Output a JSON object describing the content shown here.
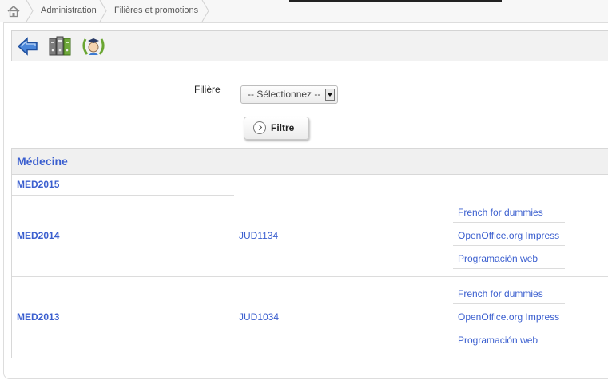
{
  "breadcrumb": {
    "items": [
      {
        "label": "Administration"
      },
      {
        "label": "Filières et promotions"
      }
    ]
  },
  "toolbar": {
    "icons": [
      "back-arrow-icon",
      "archive-cabinet-icon",
      "graduate-laurel-icon"
    ]
  },
  "filter": {
    "label": "Filière",
    "select_value": "-- Sélectionnez --",
    "button_label": "Filtre"
  },
  "filiere": {
    "name": "Médecine",
    "promotions": [
      {
        "code": "MED2015",
        "groups": []
      },
      {
        "code": "MED2014",
        "groups": [
          {
            "code": "JUD1134",
            "modules": [
              "French for dummies",
              "OpenOffice.org Impress",
              "Programación web"
            ]
          }
        ]
      },
      {
        "code": "MED2013",
        "groups": [
          {
            "code": "JUD1034",
            "modules": [
              "French for dummies",
              "OpenOffice.org Impress",
              "Programación web"
            ]
          }
        ]
      }
    ]
  },
  "colors": {
    "link": "#3b5fcf",
    "toolbar_bg": "#f2f2f2"
  }
}
